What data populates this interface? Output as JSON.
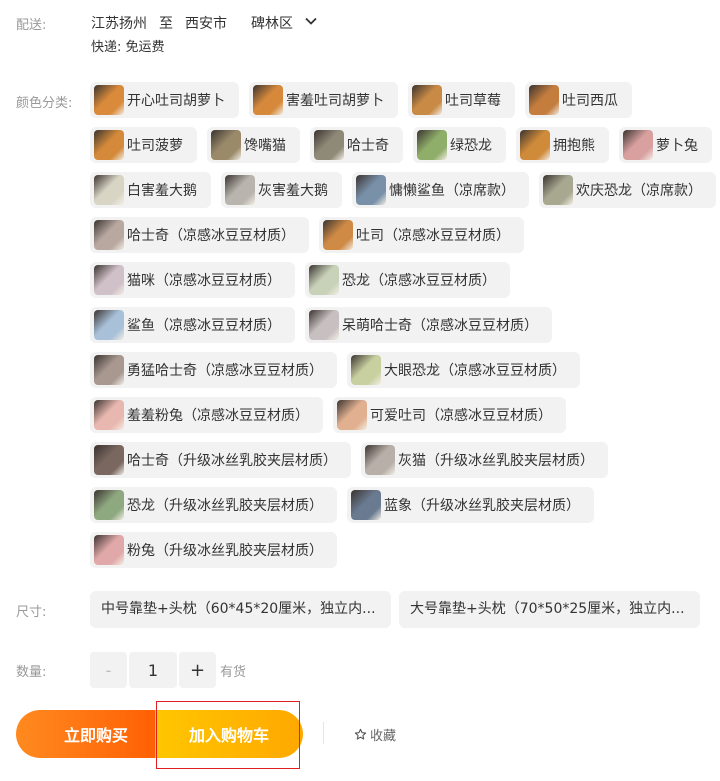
{
  "shipping": {
    "label": "配送:",
    "from": "江苏扬州",
    "to_word": "至",
    "city": "西安市",
    "district": "碑林区",
    "express": "快递: 免运费"
  },
  "color": {
    "label": "颜色分类:",
    "rows": [
      [
        {
          "label": "开心吐司胡萝卜",
          "thumb": "#d98a3a"
        },
        {
          "label": "害羞吐司胡萝卜",
          "thumb": "#d7893b"
        },
        {
          "label": "吐司草莓",
          "thumb": "#c98a45"
        },
        {
          "label": "吐司西瓜",
          "thumb": "#c47d3d"
        }
      ],
      [
        {
          "label": "吐司菠萝",
          "thumb": "#d48a3a"
        },
        {
          "label": "馋嘴猫",
          "thumb": "#9a8a6a"
        },
        {
          "label": "哈士奇",
          "thumb": "#8f8a78"
        },
        {
          "label": "绿恐龙",
          "thumb": "#8fae6a"
        },
        {
          "label": "拥抱熊",
          "thumb": "#cf8a3a"
        },
        {
          "label": "萝卜兔",
          "thumb": "#d9a0a0"
        }
      ],
      [
        {
          "label": "白害羞大鹅",
          "thumb": "#d9d5c5"
        },
        {
          "label": "灰害羞大鹅",
          "thumb": "#b9b5ae"
        },
        {
          "label": "慵懒鲨鱼（凉席款）",
          "thumb": "#7890a8"
        },
        {
          "label": "欢庆恐龙（凉席款）",
          "thumb": "#a8a890"
        }
      ],
      [
        {
          "label": "哈士奇（凉感冰豆豆材质）",
          "thumb": "#b8a8a0"
        },
        {
          "label": "吐司（凉感冰豆豆材质）",
          "thumb": "#cf8a45"
        }
      ],
      [
        {
          "label": "猫咪（凉感冰豆豆材质）",
          "thumb": "#d0c0c8"
        },
        {
          "label": "恐龙（凉感冰豆豆材质）",
          "thumb": "#c8d2b8"
        }
      ],
      [
        {
          "label": "鲨鱼（凉感冰豆豆材质）",
          "thumb": "#a8c0d8"
        },
        {
          "label": "呆萌哈士奇（凉感冰豆豆材质）",
          "thumb": "#c8c0c0"
        }
      ],
      [
        {
          "label": "勇猛哈士奇（凉感冰豆豆材质）",
          "thumb": "#a89890"
        },
        {
          "label": "大眼恐龙（凉感冰豆豆材质）",
          "thumb": "#c8d0a0"
        }
      ],
      [
        {
          "label": "羞羞粉兔（凉感冰豆豆材质）",
          "thumb": "#e8b8b0"
        },
        {
          "label": "可爱吐司（凉感冰豆豆材质）",
          "thumb": "#e0b090"
        }
      ],
      [
        {
          "label": "哈士奇（升级冰丝乳胶夹层材质）",
          "thumb": "#7a6860"
        },
        {
          "label": "灰猫（升级冰丝乳胶夹层材质）",
          "thumb": "#b8b0a8"
        }
      ],
      [
        {
          "label": "恐龙（升级冰丝乳胶夹层材质）",
          "thumb": "#8ea880"
        },
        {
          "label": "蓝象（升级冰丝乳胶夹层材质）",
          "thumb": "#6a7a90"
        }
      ],
      [
        {
          "label": "粉兔（升级冰丝乳胶夹层材质）",
          "thumb": "#e0a8a8"
        }
      ]
    ]
  },
  "size": {
    "label": "尺寸:",
    "options": [
      "中号靠垫+头枕（60*45*20厘米，独立内...",
      "大号靠垫+头枕（70*50*25厘米，独立内..."
    ]
  },
  "quantity": {
    "label": "数量:",
    "minus": "-",
    "value": "1",
    "plus": "+",
    "stock": "有货"
  },
  "actions": {
    "buy_now": "立即购买",
    "add_to_cart": "加入购物车",
    "favorite": "收藏"
  },
  "colors": {
    "buy_gradient": [
      "#ff8a1f",
      "#ff5a00"
    ],
    "cart_gradient": [
      "#ffc600",
      "#ffa800"
    ],
    "highlight": "#e02020"
  }
}
